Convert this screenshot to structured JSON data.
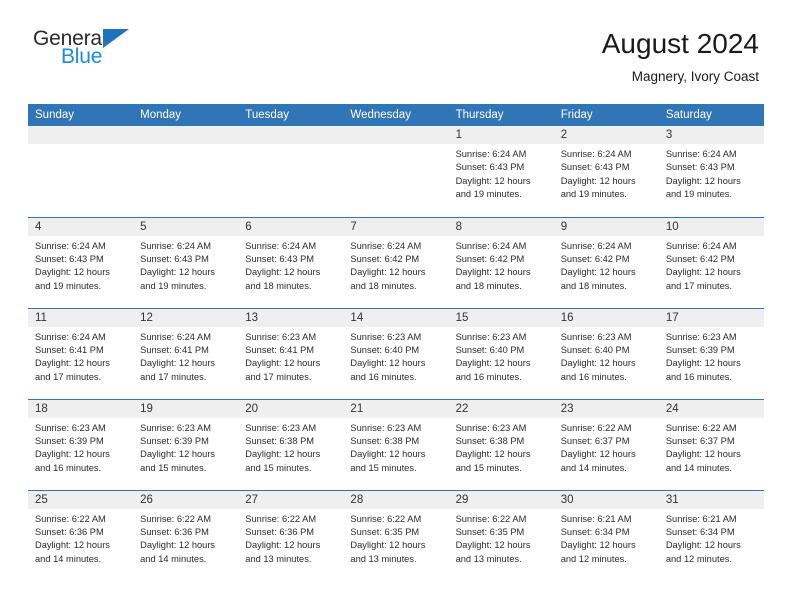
{
  "logo": {
    "word_top": "General",
    "word_bottom": "Blue",
    "triangle_color": "#1f72bd",
    "blue_color": "#1f8ae0"
  },
  "header": {
    "title": "August 2024",
    "subtitle": "Magnery, Ivory Coast"
  },
  "theme": {
    "header_bg": "#3075b6",
    "header_text": "#ffffff",
    "daynum_bg": "#efefef",
    "cell_bg": "#ffffff",
    "grid_line": "#3075b6"
  },
  "weekday_headers": [
    "Sunday",
    "Monday",
    "Tuesday",
    "Wednesday",
    "Thursday",
    "Friday",
    "Saturday"
  ],
  "labels": {
    "sunrise_prefix": "Sunrise:",
    "sunset_prefix": "Sunset:",
    "daylight_prefix": "Daylight:"
  },
  "weeks": [
    [
      {
        "blank": true,
        "day": ""
      },
      {
        "blank": true,
        "day": ""
      },
      {
        "blank": true,
        "day": ""
      },
      {
        "blank": true,
        "day": ""
      },
      {
        "blank": false,
        "day": "1",
        "sunrise": "Sunrise: 6:24 AM",
        "sunset": "Sunset: 6:43 PM",
        "daylight_line1": "Daylight: 12 hours",
        "daylight_line2": "and 19 minutes."
      },
      {
        "blank": false,
        "day": "2",
        "sunrise": "Sunrise: 6:24 AM",
        "sunset": "Sunset: 6:43 PM",
        "daylight_line1": "Daylight: 12 hours",
        "daylight_line2": "and 19 minutes."
      },
      {
        "blank": false,
        "day": "3",
        "sunrise": "Sunrise: 6:24 AM",
        "sunset": "Sunset: 6:43 PM",
        "daylight_line1": "Daylight: 12 hours",
        "daylight_line2": "and 19 minutes."
      }
    ],
    [
      {
        "blank": false,
        "day": "4",
        "sunrise": "Sunrise: 6:24 AM",
        "sunset": "Sunset: 6:43 PM",
        "daylight_line1": "Daylight: 12 hours",
        "daylight_line2": "and 19 minutes."
      },
      {
        "blank": false,
        "day": "5",
        "sunrise": "Sunrise: 6:24 AM",
        "sunset": "Sunset: 6:43 PM",
        "daylight_line1": "Daylight: 12 hours",
        "daylight_line2": "and 19 minutes."
      },
      {
        "blank": false,
        "day": "6",
        "sunrise": "Sunrise: 6:24 AM",
        "sunset": "Sunset: 6:43 PM",
        "daylight_line1": "Daylight: 12 hours",
        "daylight_line2": "and 18 minutes."
      },
      {
        "blank": false,
        "day": "7",
        "sunrise": "Sunrise: 6:24 AM",
        "sunset": "Sunset: 6:42 PM",
        "daylight_line1": "Daylight: 12 hours",
        "daylight_line2": "and 18 minutes."
      },
      {
        "blank": false,
        "day": "8",
        "sunrise": "Sunrise: 6:24 AM",
        "sunset": "Sunset: 6:42 PM",
        "daylight_line1": "Daylight: 12 hours",
        "daylight_line2": "and 18 minutes."
      },
      {
        "blank": false,
        "day": "9",
        "sunrise": "Sunrise: 6:24 AM",
        "sunset": "Sunset: 6:42 PM",
        "daylight_line1": "Daylight: 12 hours",
        "daylight_line2": "and 18 minutes."
      },
      {
        "blank": false,
        "day": "10",
        "sunrise": "Sunrise: 6:24 AM",
        "sunset": "Sunset: 6:42 PM",
        "daylight_line1": "Daylight: 12 hours",
        "daylight_line2": "and 17 minutes."
      }
    ],
    [
      {
        "blank": false,
        "day": "11",
        "sunrise": "Sunrise: 6:24 AM",
        "sunset": "Sunset: 6:41 PM",
        "daylight_line1": "Daylight: 12 hours",
        "daylight_line2": "and 17 minutes."
      },
      {
        "blank": false,
        "day": "12",
        "sunrise": "Sunrise: 6:24 AM",
        "sunset": "Sunset: 6:41 PM",
        "daylight_line1": "Daylight: 12 hours",
        "daylight_line2": "and 17 minutes."
      },
      {
        "blank": false,
        "day": "13",
        "sunrise": "Sunrise: 6:23 AM",
        "sunset": "Sunset: 6:41 PM",
        "daylight_line1": "Daylight: 12 hours",
        "daylight_line2": "and 17 minutes."
      },
      {
        "blank": false,
        "day": "14",
        "sunrise": "Sunrise: 6:23 AM",
        "sunset": "Sunset: 6:40 PM",
        "daylight_line1": "Daylight: 12 hours",
        "daylight_line2": "and 16 minutes."
      },
      {
        "blank": false,
        "day": "15",
        "sunrise": "Sunrise: 6:23 AM",
        "sunset": "Sunset: 6:40 PM",
        "daylight_line1": "Daylight: 12 hours",
        "daylight_line2": "and 16 minutes."
      },
      {
        "blank": false,
        "day": "16",
        "sunrise": "Sunrise: 6:23 AM",
        "sunset": "Sunset: 6:40 PM",
        "daylight_line1": "Daylight: 12 hours",
        "daylight_line2": "and 16 minutes."
      },
      {
        "blank": false,
        "day": "17",
        "sunrise": "Sunrise: 6:23 AM",
        "sunset": "Sunset: 6:39 PM",
        "daylight_line1": "Daylight: 12 hours",
        "daylight_line2": "and 16 minutes."
      }
    ],
    [
      {
        "blank": false,
        "day": "18",
        "sunrise": "Sunrise: 6:23 AM",
        "sunset": "Sunset: 6:39 PM",
        "daylight_line1": "Daylight: 12 hours",
        "daylight_line2": "and 16 minutes."
      },
      {
        "blank": false,
        "day": "19",
        "sunrise": "Sunrise: 6:23 AM",
        "sunset": "Sunset: 6:39 PM",
        "daylight_line1": "Daylight: 12 hours",
        "daylight_line2": "and 15 minutes."
      },
      {
        "blank": false,
        "day": "20",
        "sunrise": "Sunrise: 6:23 AM",
        "sunset": "Sunset: 6:38 PM",
        "daylight_line1": "Daylight: 12 hours",
        "daylight_line2": "and 15 minutes."
      },
      {
        "blank": false,
        "day": "21",
        "sunrise": "Sunrise: 6:23 AM",
        "sunset": "Sunset: 6:38 PM",
        "daylight_line1": "Daylight: 12 hours",
        "daylight_line2": "and 15 minutes."
      },
      {
        "blank": false,
        "day": "22",
        "sunrise": "Sunrise: 6:23 AM",
        "sunset": "Sunset: 6:38 PM",
        "daylight_line1": "Daylight: 12 hours",
        "daylight_line2": "and 15 minutes."
      },
      {
        "blank": false,
        "day": "23",
        "sunrise": "Sunrise: 6:22 AM",
        "sunset": "Sunset: 6:37 PM",
        "daylight_line1": "Daylight: 12 hours",
        "daylight_line2": "and 14 minutes."
      },
      {
        "blank": false,
        "day": "24",
        "sunrise": "Sunrise: 6:22 AM",
        "sunset": "Sunset: 6:37 PM",
        "daylight_line1": "Daylight: 12 hours",
        "daylight_line2": "and 14 minutes."
      }
    ],
    [
      {
        "blank": false,
        "day": "25",
        "sunrise": "Sunrise: 6:22 AM",
        "sunset": "Sunset: 6:36 PM",
        "daylight_line1": "Daylight: 12 hours",
        "daylight_line2": "and 14 minutes."
      },
      {
        "blank": false,
        "day": "26",
        "sunrise": "Sunrise: 6:22 AM",
        "sunset": "Sunset: 6:36 PM",
        "daylight_line1": "Daylight: 12 hours",
        "daylight_line2": "and 14 minutes."
      },
      {
        "blank": false,
        "day": "27",
        "sunrise": "Sunrise: 6:22 AM",
        "sunset": "Sunset: 6:36 PM",
        "daylight_line1": "Daylight: 12 hours",
        "daylight_line2": "and 13 minutes."
      },
      {
        "blank": false,
        "day": "28",
        "sunrise": "Sunrise: 6:22 AM",
        "sunset": "Sunset: 6:35 PM",
        "daylight_line1": "Daylight: 12 hours",
        "daylight_line2": "and 13 minutes."
      },
      {
        "blank": false,
        "day": "29",
        "sunrise": "Sunrise: 6:22 AM",
        "sunset": "Sunset: 6:35 PM",
        "daylight_line1": "Daylight: 12 hours",
        "daylight_line2": "and 13 minutes."
      },
      {
        "blank": false,
        "day": "30",
        "sunrise": "Sunrise: 6:21 AM",
        "sunset": "Sunset: 6:34 PM",
        "daylight_line1": "Daylight: 12 hours",
        "daylight_line2": "and 12 minutes."
      },
      {
        "blank": false,
        "day": "31",
        "sunrise": "Sunrise: 6:21 AM",
        "sunset": "Sunset: 6:34 PM",
        "daylight_line1": "Daylight: 12 hours",
        "daylight_line2": "and 12 minutes."
      }
    ]
  ]
}
